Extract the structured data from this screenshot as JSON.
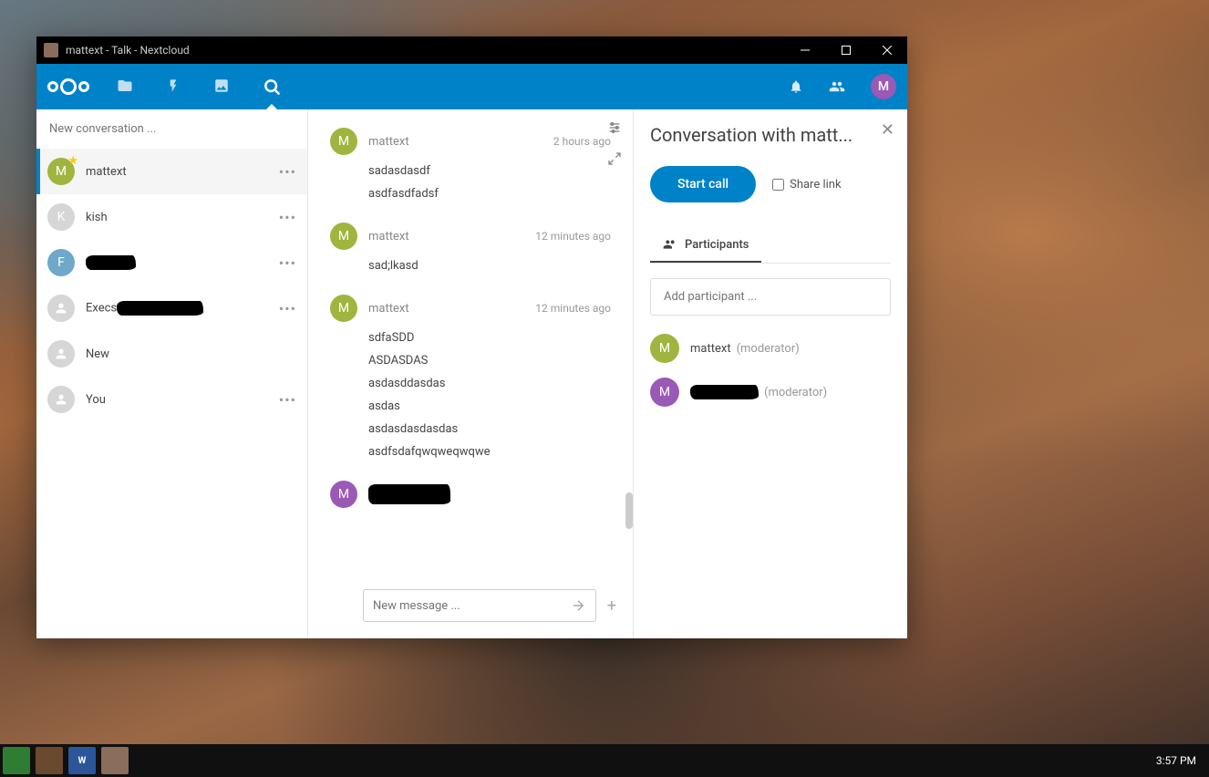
{
  "window_title": "mattext - Talk - Nextcloud",
  "header": {
    "user_initial": "M"
  },
  "sidebar": {
    "new_conversation_placeholder": "New conversation ...",
    "items": [
      {
        "initial": "M",
        "name": "mattext",
        "color": "green",
        "star": true,
        "active": true,
        "menu": true
      },
      {
        "initial": "K",
        "name": "kish",
        "color": "gray",
        "menu": true
      },
      {
        "initial": "F",
        "name": "",
        "color": "blue",
        "scribble": 55,
        "menu": true
      },
      {
        "initial": "",
        "name": "Execs",
        "color": "gray",
        "scribble": 95,
        "menu": true
      },
      {
        "initial": "",
        "name": "New",
        "color": "gray"
      },
      {
        "initial": "",
        "name": "You",
        "color": "gray",
        "menu": true
      }
    ]
  },
  "chat": {
    "groups": [
      {
        "author": "mattext",
        "initial": "M",
        "color": "green",
        "time": "2 hours ago",
        "lines": [
          "sadasdasdf",
          "asdfasdfadsf"
        ]
      },
      {
        "author": "mattext",
        "initial": "M",
        "color": "green",
        "time": "12 minutes ago",
        "lines": [
          "sad;lkasd"
        ]
      },
      {
        "author": "mattext",
        "initial": "M",
        "color": "green",
        "time": "12 minutes ago",
        "lines": [
          "sdfaSDD",
          "ASDASDAS",
          "asdasddasdas",
          "asdas",
          "asdasdasdasdas",
          "asdfsdafqwqweqwqwe"
        ]
      },
      {
        "author": "",
        "initial": "M",
        "color": "purple",
        "scribble": 90,
        "lines": []
      }
    ],
    "input_placeholder": "New message ..."
  },
  "right_panel": {
    "title": "Conversation with matt...",
    "start_call": "Start call",
    "share_link": "Share link",
    "tab_label": "Participants",
    "add_participant_placeholder": "Add participant ...",
    "participants": [
      {
        "initial": "M",
        "name": "mattext",
        "role": "(moderator)",
        "color": "green"
      },
      {
        "initial": "M",
        "name": "",
        "role": "(moderator)",
        "color": "purple",
        "scribble": 75
      }
    ]
  },
  "taskbar": {
    "clock": "3:57 PM"
  }
}
